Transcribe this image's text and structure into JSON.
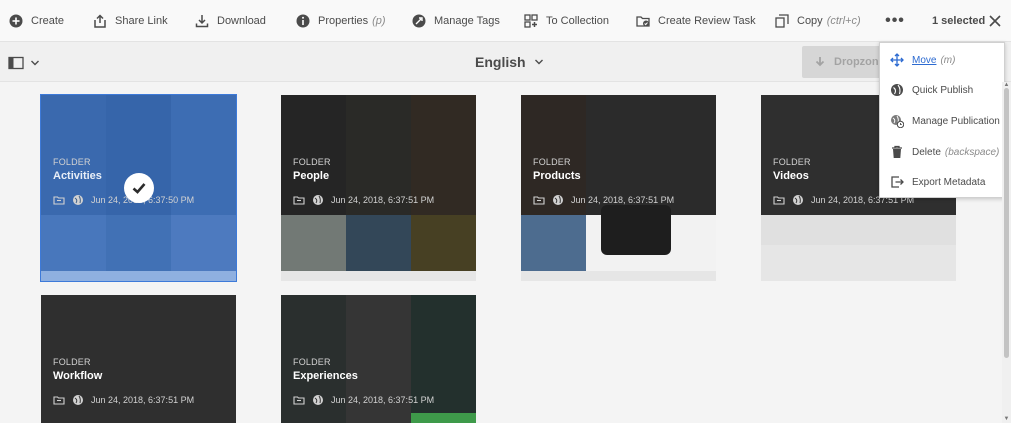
{
  "toolbar": {
    "create": "Create",
    "share_link": "Share Link",
    "download": "Download",
    "properties": "Properties",
    "properties_shortcut": "(p)",
    "manage_tags": "Manage Tags",
    "to_collection": "To Collection",
    "create_review_task": "Create Review Task",
    "copy": "Copy",
    "copy_shortcut": "(ctrl+c)",
    "more": "•••",
    "selected_count": "1 selected"
  },
  "subbar": {
    "language": "English",
    "dropzone": "Dropzone"
  },
  "cards": [
    {
      "kind": "FOLDER",
      "name": "Activities",
      "date": "Jun 24, 2018, 6:37:50 PM",
      "selected": true
    },
    {
      "kind": "FOLDER",
      "name": "People",
      "date": "Jun 24, 2018, 6:37:51 PM"
    },
    {
      "kind": "FOLDER",
      "name": "Products",
      "date": "Jun 24, 2018, 6:37:51 PM"
    },
    {
      "kind": "FOLDER",
      "name": "Videos",
      "date": "Jun 24, 2018, 6:37:51 PM"
    },
    {
      "kind": "FOLDER",
      "name": "Workflow",
      "date": "Jun 24, 2018, 6:37:51 PM"
    },
    {
      "kind": "FOLDER",
      "name": "Experiences",
      "date": "Jun 24, 2018, 6:37:51 PM"
    }
  ],
  "menu": {
    "items": [
      {
        "label": "Move",
        "shortcut": "(m)",
        "icon": "move-icon"
      },
      {
        "label": "Quick Publish",
        "shortcut": "",
        "icon": "globe-icon"
      },
      {
        "label": "Manage Publication",
        "shortcut": "",
        "icon": "globe-clock-icon"
      },
      {
        "label": "Delete",
        "shortcut": "(backspace)",
        "icon": "trash-icon"
      },
      {
        "label": "Export Metadata",
        "shortcut": "",
        "icon": "export-icon"
      }
    ]
  },
  "colors": {
    "selection": "#3d7ad9",
    "link": "#2d6bd1"
  }
}
